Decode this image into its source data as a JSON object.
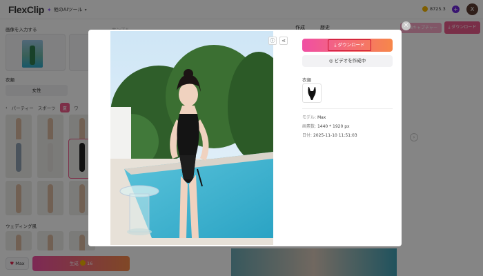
{
  "app": {
    "logo": "FlexClip",
    "tools_menu": "他のAIツール",
    "credits": "8725.3",
    "user_initial": "X"
  },
  "sidebar": {
    "input_label": "画像を入力する",
    "sample_label": "サンプル",
    "clothes_label": "衣類",
    "gender": "女性",
    "categories": [
      "パーティー",
      "スポーツ",
      "夏",
      "ワ"
    ],
    "section_wedding": "ウェディング風",
    "max_label": "Max",
    "generate_label": "生成",
    "generate_cost": "16"
  },
  "background_main": {
    "tab_works": "作成",
    "tab_history": "歴史",
    "pink_btn": "動画キャプチャー",
    "download_btn": "ダウンロード"
  },
  "modal": {
    "download_label": "ダウンロード",
    "video_label": "ビデオを作成中",
    "clothes_label": "衣類",
    "model_key": "モデル:",
    "model_value": "Max",
    "size_key": "画素数:",
    "size_value": "1440 * 1920 px",
    "date_key": "日付:",
    "date_value": "2025-11-10 11:51:03"
  },
  "icons": {
    "close": "close-icon",
    "info": "info-icon",
    "share": "share-icon",
    "download": "download-icon",
    "video": "video-icon"
  },
  "colors": {
    "accent_pink": "#f04fa3",
    "accent_orange": "#f7874a",
    "highlight_red": "#c8102e"
  }
}
